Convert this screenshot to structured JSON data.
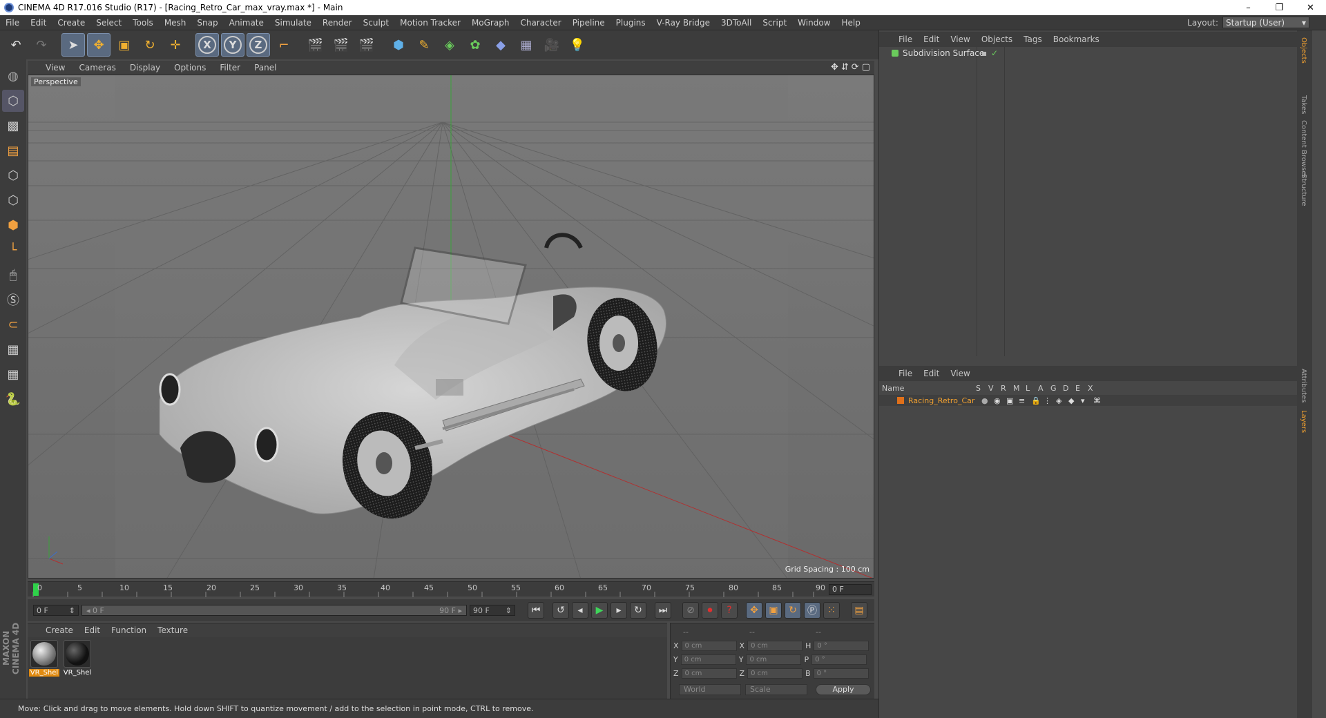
{
  "window": {
    "title": "CINEMA 4D R17.016 Studio (R17) - [Racing_Retro_Car_max_vray.max *] - Main",
    "minimize": "–",
    "restore": "❐",
    "close": "✕"
  },
  "menubar": {
    "items": [
      "File",
      "Edit",
      "Create",
      "Select",
      "Tools",
      "Mesh",
      "Snap",
      "Animate",
      "Simulate",
      "Render",
      "Sculpt",
      "Motion Tracker",
      "MoGraph",
      "Character",
      "Pipeline",
      "Plugins",
      "V-Ray Bridge",
      "3DToAll",
      "Script",
      "Window",
      "Help"
    ],
    "layout_label": "Layout:",
    "layout_value": "Startup (User)"
  },
  "toolbar": {
    "x_label": "X",
    "y_label": "Y",
    "z_label": "Z"
  },
  "viewport": {
    "menu": [
      "View",
      "Cameras",
      "Display",
      "Options",
      "Filter",
      "Panel"
    ],
    "camera_label": "Perspective",
    "grid_spacing": "Grid Spacing : 100 cm"
  },
  "timeline": {
    "ticks": [
      "0",
      "5",
      "10",
      "15",
      "20",
      "25",
      "30",
      "35",
      "40",
      "45",
      "50",
      "55",
      "60",
      "65",
      "70",
      "75",
      "80",
      "85",
      "90"
    ],
    "frame_value": "0 F"
  },
  "transport": {
    "start": "0 F",
    "slider_left": "◂ 0 F",
    "slider_right": "90 F ▸",
    "end": "90 F"
  },
  "materials": {
    "menu": [
      "Create",
      "Edit",
      "Function",
      "Texture"
    ],
    "items": [
      {
        "name": "VR_Shel"
      },
      {
        "name": "VR_Shel"
      }
    ]
  },
  "coords": {
    "header": [
      "--",
      "--",
      "--"
    ],
    "rows": [
      {
        "a": "X",
        "av": "0 cm",
        "b": "X",
        "bv": "0 cm",
        "c": "H",
        "cv": "0 °"
      },
      {
        "a": "Y",
        "av": "0 cm",
        "b": "Y",
        "bv": "0 cm",
        "c": "P",
        "cv": "0 °"
      },
      {
        "a": "Z",
        "av": "0 cm",
        "b": "Z",
        "bv": "0 cm",
        "c": "B",
        "cv": "0 °"
      }
    ],
    "space": "World",
    "mode": "Scale",
    "apply": "Apply"
  },
  "objects": {
    "menu": [
      "File",
      "Edit",
      "View",
      "Objects",
      "Tags",
      "Bookmarks"
    ],
    "item": "Subdivision Surface"
  },
  "layers": {
    "menu": [
      "File",
      "Edit",
      "View"
    ],
    "columns": [
      "Name",
      "S",
      "V",
      "R",
      "M",
      "L",
      "A",
      "G",
      "D",
      "E",
      "X"
    ],
    "item": "Racing_Retro_Car"
  },
  "sidetabs": [
    "Objects",
    "Takes",
    "Content Browser",
    "Structure",
    "Attributes",
    "Layers"
  ],
  "status": "Move: Click and drag to move elements. Hold down SHIFT to quantize movement / add to the selection in point mode, CTRL to remove.",
  "brand": "MAXON CINEMA 4D"
}
